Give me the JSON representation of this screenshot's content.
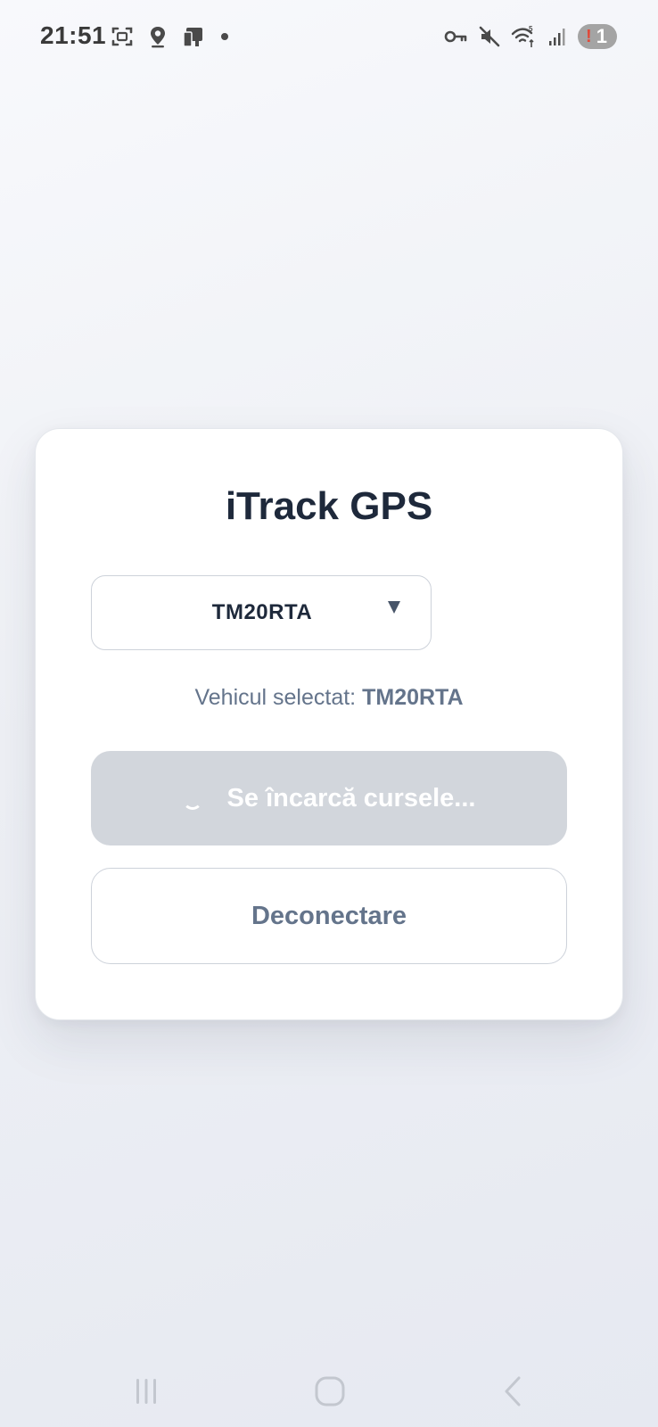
{
  "status_bar": {
    "time": "21:51",
    "left_icons": [
      "screenshot-icon",
      "location-pin-icon",
      "phone-transfer-icon",
      "dot-icon"
    ],
    "right_icons": [
      "vpn-key-icon",
      "mute-icon",
      "wifi-icon",
      "signal-icon"
    ],
    "notification_count": "1",
    "notification_alert": "!"
  },
  "card": {
    "title": "iTrack GPS",
    "vehicle_select": {
      "value": "TM20RTA",
      "arrow": "▼"
    },
    "selected_label": "Vehicul selectat:",
    "selected_value": "TM20RTA",
    "loading_button_label": "Se încarcă cursele...",
    "logout_button_label": "Deconectare"
  },
  "nav_bar": {
    "buttons": [
      "recent-apps-icon",
      "home-icon",
      "back-icon"
    ]
  },
  "colors": {
    "title": "#1e293b",
    "muted_text": "#64748b",
    "loading_button_bg": "#d2d6dc",
    "border": "#cdd2da",
    "card_bg": "#ffffff"
  }
}
